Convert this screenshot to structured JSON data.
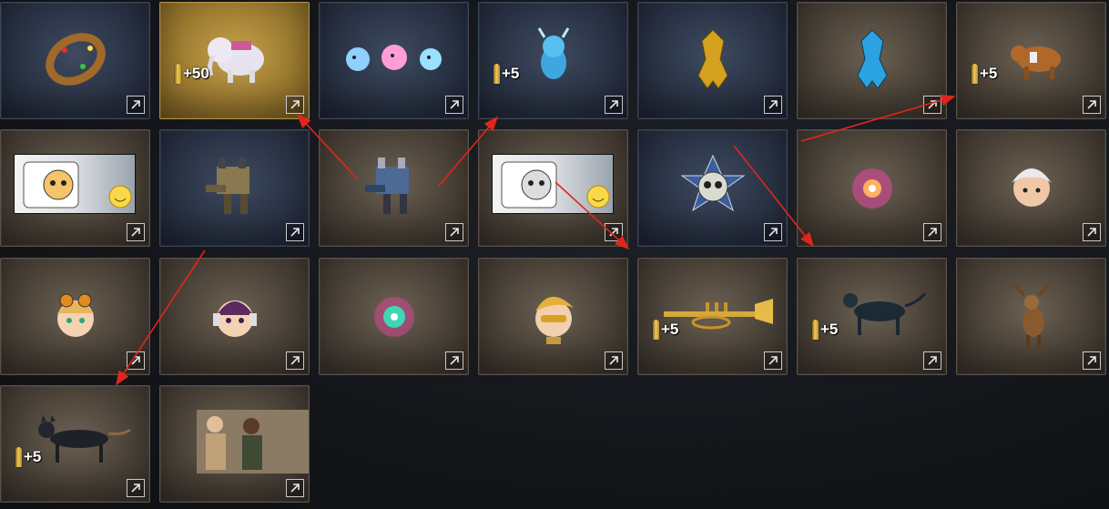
{
  "colors": {
    "tile_brown": "#4a4238",
    "tile_blue": "#2a3345",
    "tile_gold": "#9c7b30",
    "arrow_red": "#e0261b",
    "ammo_text": "#ffffff"
  },
  "icons": {
    "link": "external-link-icon",
    "ammo": "bullet-icon"
  },
  "tiles": [
    {
      "row": 0,
      "col": 0,
      "style": "blue",
      "item": "jeweled-ring-icon",
      "ammo": null
    },
    {
      "row": 0,
      "col": 1,
      "style": "gold",
      "item": "elephant-mount-icon",
      "ammo": "+50"
    },
    {
      "row": 0,
      "col": 2,
      "style": "blue",
      "item": "baby-elephants-icon",
      "ammo": null
    },
    {
      "row": 0,
      "col": 3,
      "style": "blue",
      "item": "blue-dragon-pet-icon",
      "ammo": "+5"
    },
    {
      "row": 0,
      "col": 4,
      "style": "blue",
      "item": "gold-armor-icon",
      "ammo": null
    },
    {
      "row": 0,
      "col": 5,
      "style": "brown",
      "item": "blue-armor-icon",
      "ammo": null
    },
    {
      "row": 0,
      "col": 6,
      "style": "brown",
      "item": "ox-pet-icon",
      "ammo": "+5"
    },
    {
      "row": 1,
      "col": 0,
      "style": "brown",
      "item": "girl-emote-banner-icon",
      "ammo": null
    },
    {
      "row": 1,
      "col": 1,
      "style": "blue",
      "item": "gold-mech-icon",
      "ammo": null
    },
    {
      "row": 1,
      "col": 2,
      "style": "brown",
      "item": "blue-mech-icon",
      "ammo": null
    },
    {
      "row": 1,
      "col": 3,
      "style": "brown",
      "item": "skull-emote-banner-icon",
      "ammo": null
    },
    {
      "row": 1,
      "col": 4,
      "style": "blue",
      "item": "skull-emblem-icon",
      "ammo": null
    },
    {
      "row": 1,
      "col": 5,
      "style": "brown",
      "item": "orange-orb-icon",
      "ammo": null
    },
    {
      "row": 1,
      "col": 6,
      "style": "brown",
      "item": "white-hair-head-icon",
      "ammo": null
    },
    {
      "row": 2,
      "col": 0,
      "style": "brown",
      "item": "goggles-girl-head-icon",
      "ammo": null
    },
    {
      "row": 2,
      "col": 1,
      "style": "brown",
      "item": "headset-girl-head-icon",
      "ammo": null
    },
    {
      "row": 2,
      "col": 2,
      "style": "brown",
      "item": "teal-orb-icon",
      "ammo": null
    },
    {
      "row": 2,
      "col": 3,
      "style": "brown",
      "item": "blond-boy-head-icon",
      "ammo": null
    },
    {
      "row": 2,
      "col": 4,
      "style": "brown",
      "item": "golden-trumpet-icon",
      "ammo": "+5"
    },
    {
      "row": 2,
      "col": 5,
      "style": "brown",
      "item": "black-panther-icon",
      "ammo": "+5"
    },
    {
      "row": 2,
      "col": 6,
      "style": "brown",
      "item": "deer-pet-icon",
      "ammo": null
    },
    {
      "row": 3,
      "col": 0,
      "style": "brown",
      "item": "black-cat-icon",
      "ammo": "+5"
    },
    {
      "row": 3,
      "col": 1,
      "style": "brown",
      "item": "two-soldiers-icon",
      "ammo": null
    }
  ]
}
